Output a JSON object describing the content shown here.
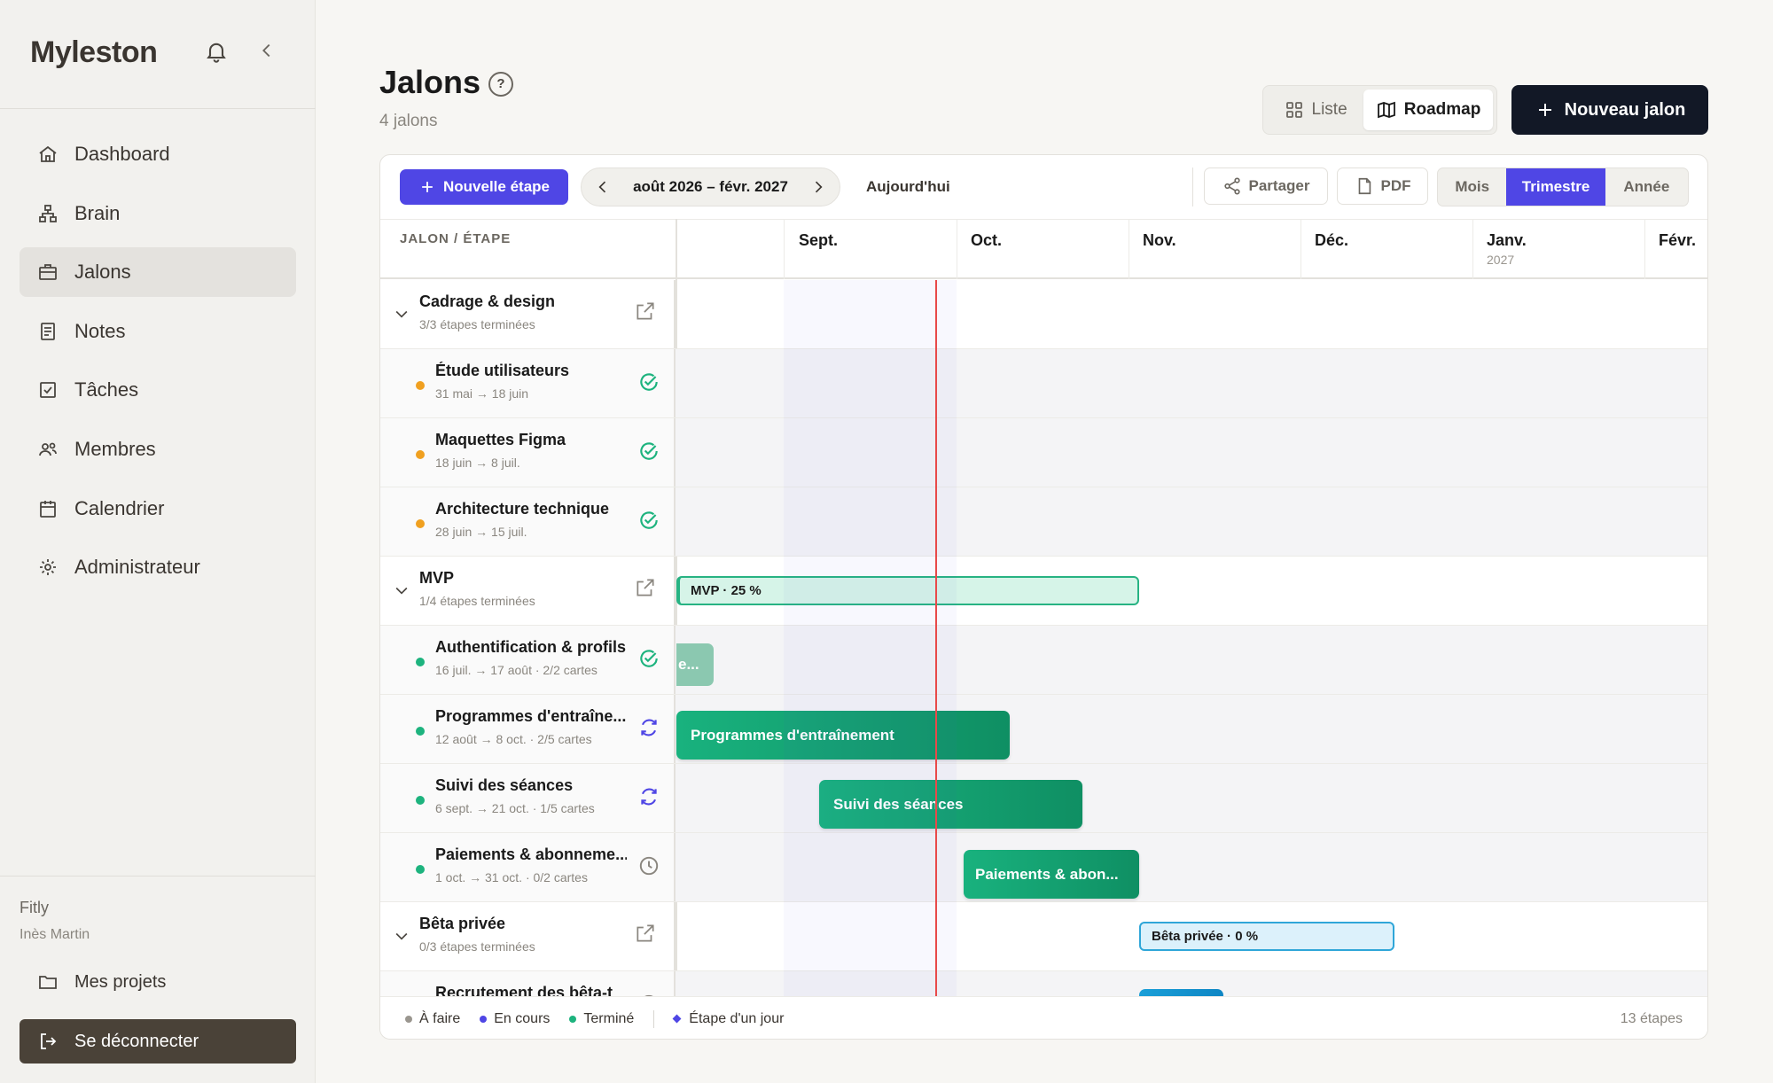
{
  "app": {
    "name": "Myleston"
  },
  "sidebar": {
    "items": [
      {
        "label": "Dashboard",
        "icon": "home-icon"
      },
      {
        "label": "Brain",
        "icon": "network-icon"
      },
      {
        "label": "Jalons",
        "icon": "briefcase-icon",
        "active": true
      },
      {
        "label": "Notes",
        "icon": "document-icon"
      },
      {
        "label": "Tâches",
        "icon": "checkbox-icon"
      },
      {
        "label": "Membres",
        "icon": "users-icon"
      },
      {
        "label": "Calendrier",
        "icon": "calendar-icon"
      },
      {
        "label": "Administrateur",
        "icon": "gear-icon"
      }
    ],
    "workspace": "Fitly",
    "user": "Inès Martin",
    "projects_label": "Mes projets",
    "logout_label": "Se déconnecter"
  },
  "header": {
    "title": "Jalons",
    "help": "?",
    "subtitle": "4 jalons",
    "view_list": "Liste",
    "view_roadmap": "Roadmap",
    "new_button": "Nouveau jalon"
  },
  "toolbar": {
    "new_step": "Nouvelle étape",
    "range": "août 2026 – févr. 2027",
    "today": "Aujourd'hui",
    "share": "Partager",
    "pdf": "PDF",
    "scales": [
      "Mois",
      "Trimestre",
      "Année"
    ],
    "active_scale": "Trimestre"
  },
  "grid": {
    "column_label": "JALON / ÉTAPE",
    "months": [
      "Sept.",
      "Oct.",
      "Nov.",
      "Déc.",
      "Janv.",
      "Févr."
    ],
    "year_label": "2027"
  },
  "rows": [
    {
      "type": "group",
      "title": "Cadrage & design",
      "sub": "3/3 étapes terminées"
    },
    {
      "type": "step",
      "title": "Étude utilisateurs",
      "sub": "31 mai → 18 juin",
      "dot": "#f0a020",
      "status": "check-circle-icon"
    },
    {
      "type": "step",
      "title": "Maquettes Figma",
      "sub": "18 juin → 8 juil.",
      "dot": "#f0a020",
      "status": "check-circle-icon"
    },
    {
      "type": "step",
      "title": "Architecture technique",
      "sub": "28 juin → 15 juil.",
      "dot": "#f0a020",
      "status": "check-circle-icon"
    },
    {
      "type": "group",
      "title": "MVP",
      "sub": "1/4 étapes terminées",
      "bar": "MVP · 25 %"
    },
    {
      "type": "step",
      "title": "Authentification & profils",
      "sub": "16 juil. → 17 août · 2/2 cartes",
      "dot": "#1db37e",
      "status": "check-circle-icon",
      "bar": "e..."
    },
    {
      "type": "step",
      "title": "Programmes d'entraîne...",
      "sub": "12 août → 8 oct. · 2/5 cartes",
      "dot": "#1db37e",
      "status": "refresh-icon",
      "bar": "Programmes d'entraînement"
    },
    {
      "type": "step",
      "title": "Suivi des séances",
      "sub": "6 sept. → 21 oct. · 1/5 cartes",
      "dot": "#1db37e",
      "status": "refresh-icon",
      "bar": "Suivi des séances"
    },
    {
      "type": "step",
      "title": "Paiements & abonneme...",
      "sub": "1 oct. → 31 oct. · 0/2 cartes",
      "dot": "#1db37e",
      "status": "clock-icon",
      "bar": "Paiements & abon..."
    },
    {
      "type": "group",
      "title": "Bêta privée",
      "sub": "0/3 étapes terminées",
      "bar": "Bêta privée · 0 %"
    },
    {
      "type": "step",
      "title": "Recrutement des bêta-t",
      "sub": "",
      "dot": "#1db37e",
      "status": "clock-icon"
    }
  ],
  "legend": {
    "todo": "À faire",
    "in_progress": "En cours",
    "done": "Terminé",
    "one_day": "Étape d'un jour",
    "count": "13 étapes"
  },
  "colors": {
    "accent": "#4f46e5",
    "today_line": "#e84a4a",
    "green": "#19b27e",
    "blue": "#1a9fd8",
    "dark": "#121826"
  }
}
